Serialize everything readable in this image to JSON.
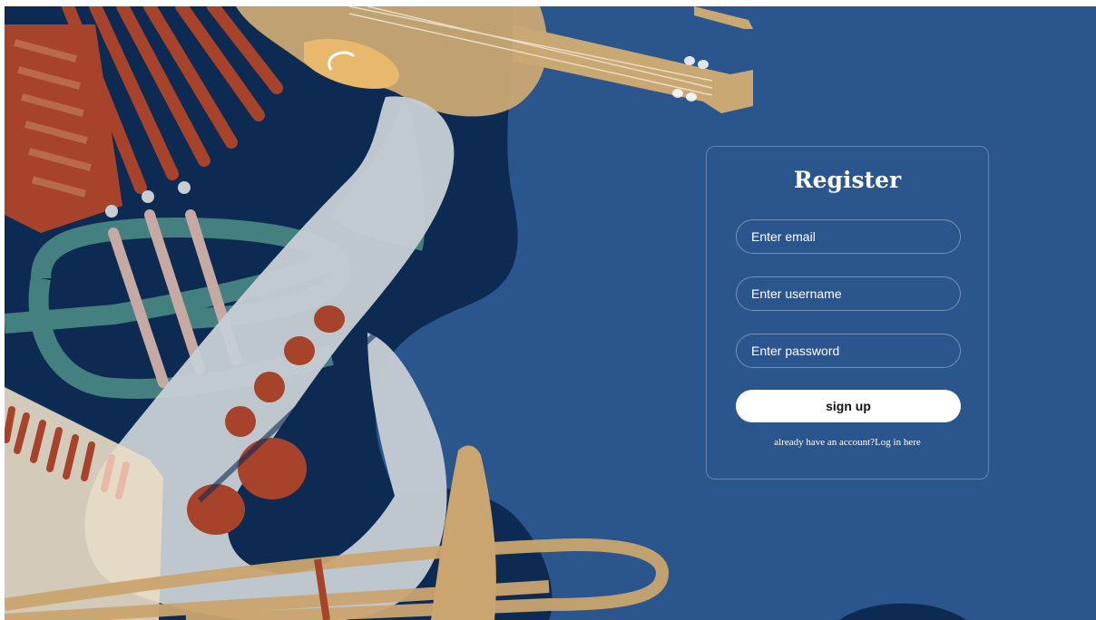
{
  "colors": {
    "background": "#2b568d",
    "navy_shape": "#0d2a52",
    "accordion_red": "#a8432b",
    "violin_tan": "#c9a874",
    "trumpet_teal": "#4e9088",
    "sax_silver": "#c6cdd3",
    "trombone_gold": "#caa56f"
  },
  "icons": {
    "background_art": "jazz-instruments-illustration"
  },
  "register": {
    "title": "Register",
    "email_placeholder": "Enter email",
    "username_placeholder": "Enter username",
    "password_placeholder": "Enter password",
    "signup_label": "sign up",
    "login_prompt": "already have an account?",
    "login_link": "Log in here"
  }
}
